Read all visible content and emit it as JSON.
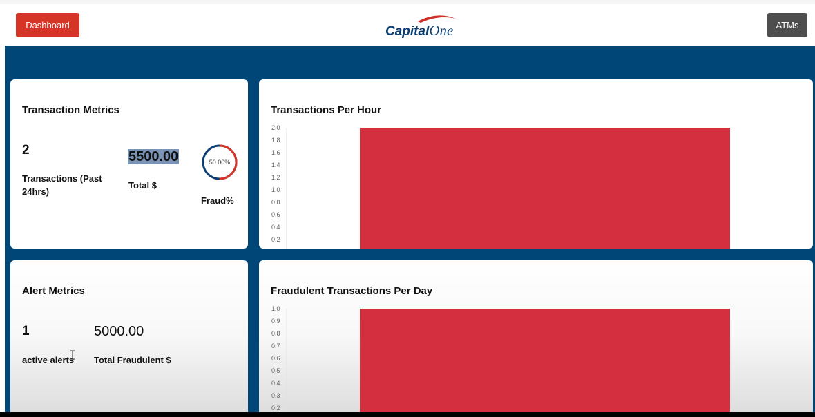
{
  "header": {
    "dashboard_label": "Dashboard",
    "atms_label": "ATMs",
    "logo_text": "Capital",
    "logo_text_one": "One",
    "brand_red": "#d43527",
    "brand_blue": "#004677"
  },
  "transaction_metrics": {
    "title": "Transaction Metrics",
    "count": "2",
    "count_label": "Transactions (Past 24hrs)",
    "total": "5500.00",
    "total_label": "Total $",
    "fraud_percent": "50.00%",
    "fraud_fraction": 0.5,
    "fraud_label": "Fraud%"
  },
  "alert_metrics": {
    "title": "Alert Metrics",
    "active_alerts": "1",
    "active_alerts_label": "active alerts",
    "total_fraudulent": "5000.00",
    "total_fraudulent_label": "Total Fraudulent $"
  },
  "chart_data": [
    {
      "type": "bar",
      "title": "Transactions Per Hour",
      "categories": [
        ""
      ],
      "values": [
        2
      ],
      "ylim": [
        0.2,
        2.0
      ],
      "yticks": [
        "2.0",
        "1.8",
        "1.6",
        "1.4",
        "1.2",
        "1.0",
        "0.8",
        "0.6",
        "0.4",
        "0.2"
      ],
      "color": "#d32f3e",
      "grid": false
    },
    {
      "type": "bar",
      "title": "Fraudulent Transactions Per Day",
      "categories": [
        ""
      ],
      "values": [
        1
      ],
      "ylim": [
        0.2,
        1.0
      ],
      "yticks": [
        "1.0",
        "0.9",
        "0.8",
        "0.7",
        "0.6",
        "0.5",
        "0.4",
        "0.3",
        "0.2"
      ],
      "color": "#d32f3e",
      "grid": false
    }
  ]
}
